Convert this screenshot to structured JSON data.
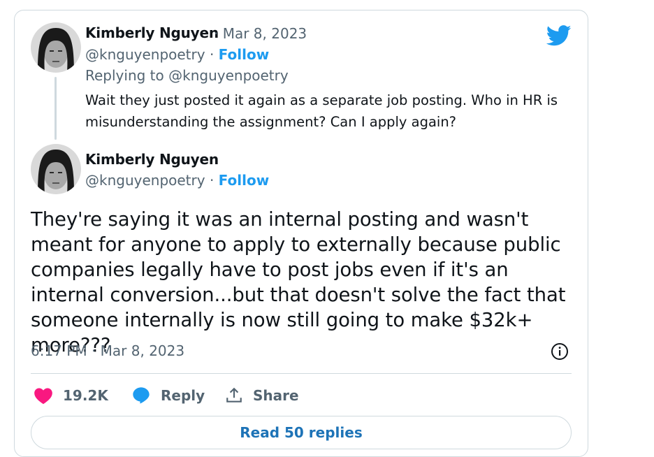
{
  "tweet_reply": {
    "author_name": "Kimberly Nguyen",
    "separator": " · ",
    "date": "Mar 8, 2023",
    "handle": "@knguyenpoetry",
    "follow_label": "Follow",
    "replying_prefix": "Replying to ",
    "replying_handle": "@knguyenpoetry",
    "text": "Wait they just posted it again as a separate job posting. Who in HR is misunderstanding the assignment? Can I apply again?"
  },
  "tweet_main": {
    "author_name": "Kimberly Nguyen",
    "handle": "@knguyenpoetry",
    "follow_label": "Follow",
    "text": "They're saying it was an internal posting and wasn't meant for anyone to apply to externally because public companies legally have to post jobs even if it's an internal conversion...but that doesn't solve the fact that someone internally is now still going to make $32k+ more???",
    "timestamp": "6:17 PM · Mar 8, 2023"
  },
  "actions": {
    "likes": "19.2K",
    "reply_label": "Reply",
    "share_label": "Share"
  },
  "read_replies_label": "Read 50 replies",
  "colors": {
    "accent": "#1d9bf0",
    "heart": "#f91880",
    "muted": "#536471",
    "border": "#cfd9de"
  },
  "icons": [
    "twitter-bird-icon",
    "heart-icon",
    "reply-bubble-icon",
    "share-icon",
    "info-icon"
  ]
}
